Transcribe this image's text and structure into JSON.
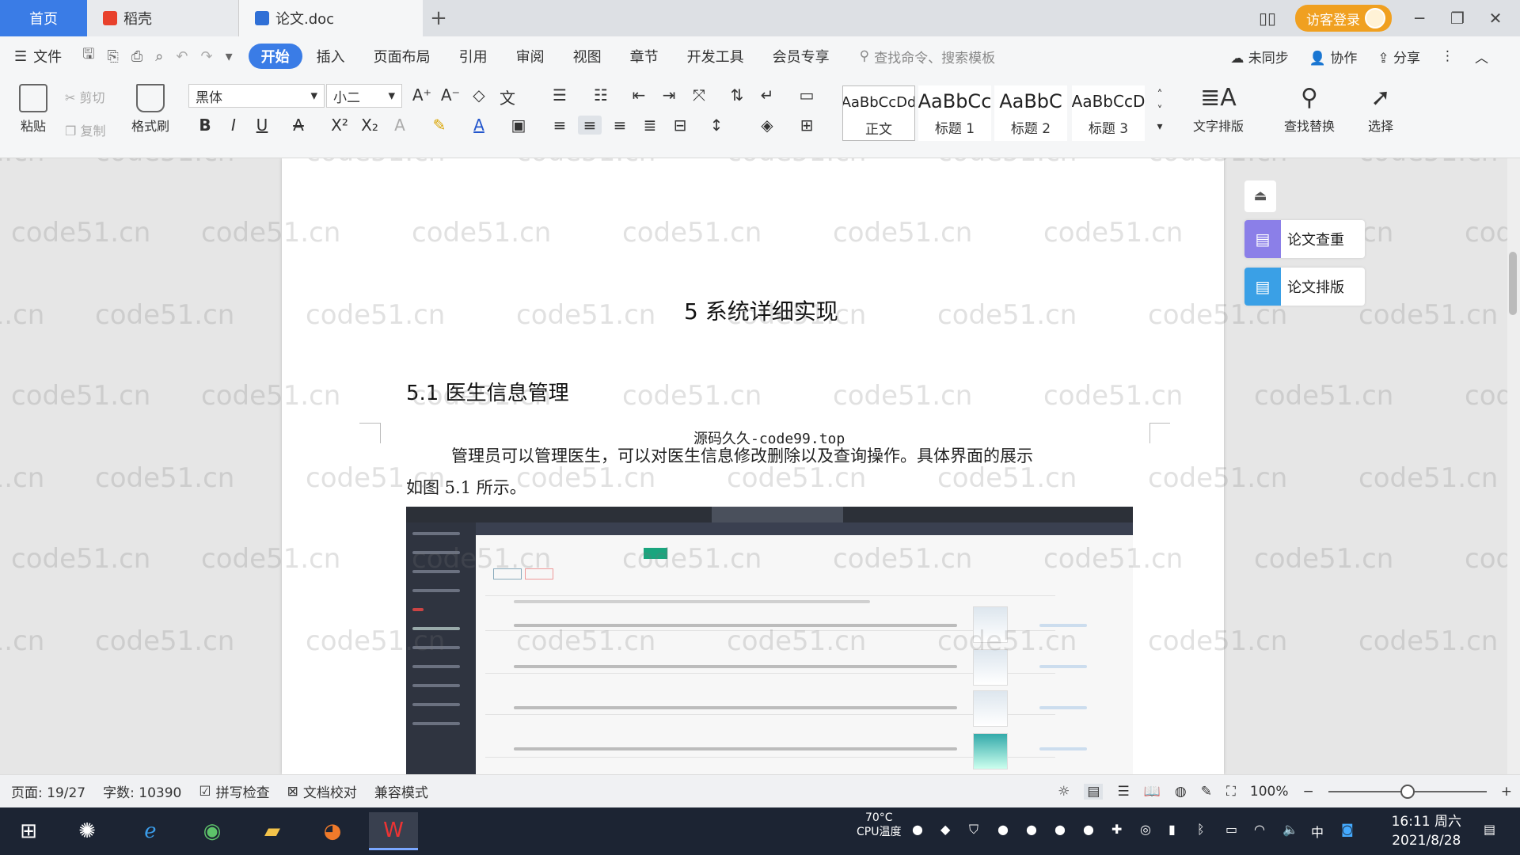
{
  "tabs": {
    "home": "首页",
    "daoke": "稻壳",
    "doc": "论文.doc",
    "plus": "+"
  },
  "titlebar": {
    "visitor_login": "访客登录",
    "minimize": "─",
    "restore": "❐",
    "close": "✕",
    "layout_icon": "▯▯"
  },
  "menubar": {
    "file": "文件",
    "items": [
      "开始",
      "插入",
      "页面布局",
      "引用",
      "审阅",
      "视图",
      "章节",
      "开发工具",
      "会员专享"
    ],
    "search": "查找命令、搜索模板",
    "not_synced": "未同步",
    "collaborate": "协作",
    "share": "分享"
  },
  "ribbon": {
    "paste": "粘贴",
    "cut": "剪切",
    "copy": "复制",
    "format_painter": "格式刷",
    "font_name": "黑体",
    "font_size": "小二",
    "styles": [
      {
        "sample": "AaBbCcDd",
        "name": "正文"
      },
      {
        "sample": "AaBbCc",
        "name": "标题 1"
      },
      {
        "sample": "AaBbC",
        "name": "标题 2"
      },
      {
        "sample": "AaBbCcD",
        "name": "标题 3"
      }
    ],
    "text_layout": "文字排版",
    "find_replace": "查找替换",
    "select": "选择"
  },
  "document": {
    "chapter_heading": "5 系统详细实现",
    "section_heading": "5.1  医生信息管理",
    "source_line": "源码久久-code99.top",
    "body_line1": "管理员可以管理医生，可以对医生信息修改删除以及查询操作。具体界面的展示",
    "body_line2": "如图 5.1 所示。",
    "watermark": "code51.cn"
  },
  "float_panel": {
    "check": "论文查重",
    "layout": "论文排版"
  },
  "statusbar": {
    "page": "页面: 19/27",
    "words": "字数: 10390",
    "spell_check": "拼写检查",
    "doc_proof": "文档校对",
    "compat_mode": "兼容模式",
    "zoom": "100%",
    "zoom_level": 0.5
  },
  "taskbar": {
    "cpu_temp": "70°C",
    "cpu_label": "CPU温度",
    "ime": "中",
    "time": "16:11 周六",
    "date": "2021/8/28"
  },
  "colors": {
    "accent": "#3a7ce6",
    "visitor": "#f0a020",
    "taskbar": "#1c2433"
  }
}
